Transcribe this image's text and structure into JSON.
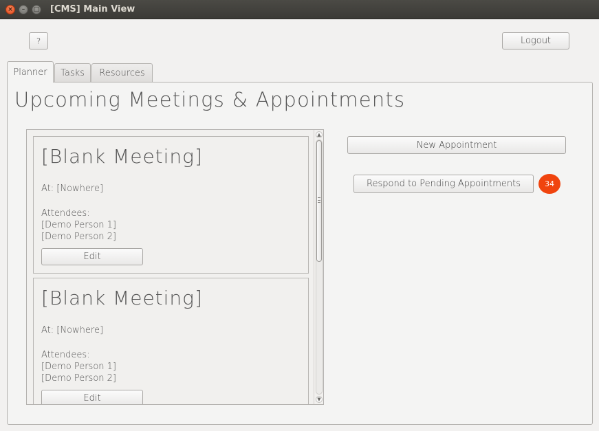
{
  "window": {
    "title": "[CMS] Main View",
    "controls": {
      "close": "×",
      "minimize": "–",
      "maximize": "□"
    }
  },
  "toolbar": {
    "help_label": "?",
    "logout_label": "Logout"
  },
  "tabs": [
    {
      "label": "Planner",
      "active": true
    },
    {
      "label": "Tasks",
      "active": false
    },
    {
      "label": "Resources",
      "active": false
    }
  ],
  "planner": {
    "title": "Upcoming Meetings & Appointments",
    "meetings": [
      {
        "title": "[Blank Meeting]",
        "location": "At: [Nowhere]",
        "attendees_label": "Attendees:",
        "attendees": [
          "[Demo Person 1]",
          "[Demo Person 2]"
        ],
        "edit_label": "Edit"
      },
      {
        "title": "[Blank Meeting]",
        "location": "At: [Nowhere]",
        "attendees_label": "Attendees:",
        "attendees": [
          "[Demo Person 1]",
          "[Demo Person 2]"
        ],
        "edit_label": "Edit"
      }
    ],
    "scroll": {
      "up_icon": "▲",
      "down_icon": "▼"
    },
    "new_appointment_label": "New Appointment",
    "respond_label": "Respond to Pending Appointments",
    "pending_count": "34"
  },
  "colors": {
    "badge": "#f0440e",
    "titlebar": "#3c3b37",
    "close_button": "#e2471a"
  }
}
